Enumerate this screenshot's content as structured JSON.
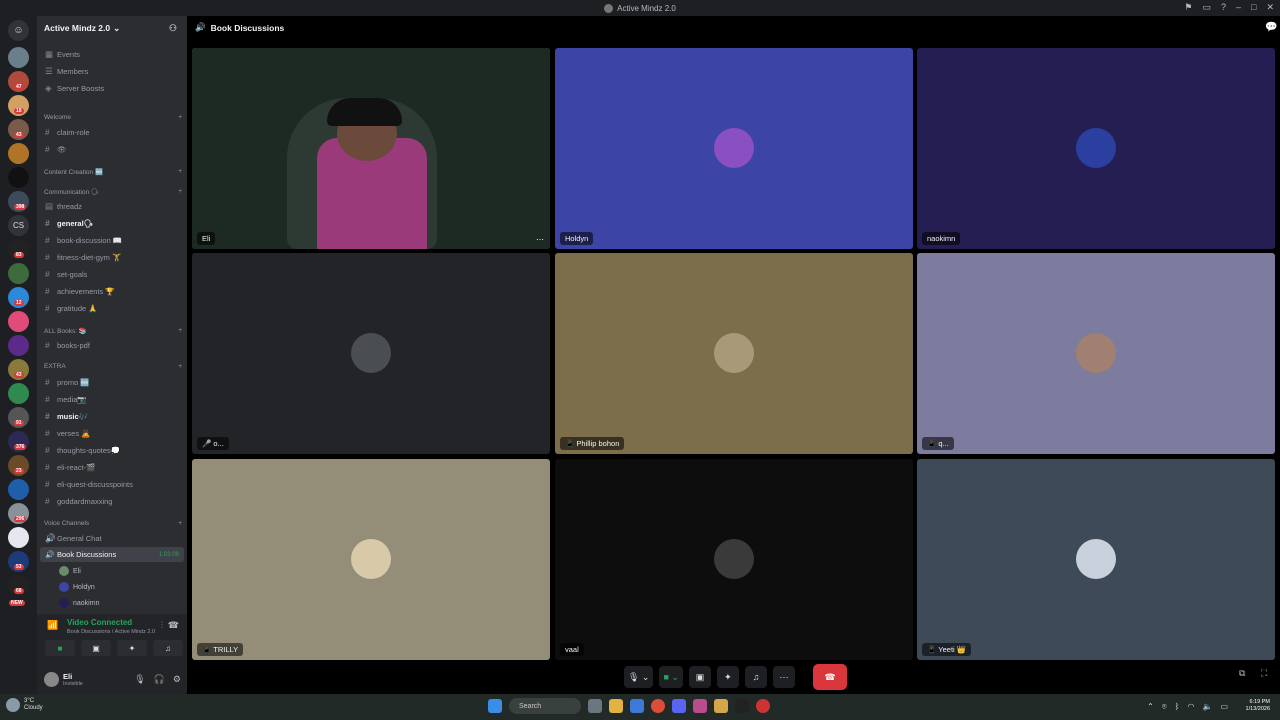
{
  "window": {
    "title": "Active Mindz 2.0"
  },
  "guild": {
    "name": "Active Mindz 2.0",
    "chevron": "⌄"
  },
  "nav_items": [
    {
      "label": "Events"
    },
    {
      "label": "Members"
    },
    {
      "label": "Server Boosts"
    }
  ],
  "categories": {
    "welcome": "Welcome",
    "content_creation": "Content Creation 🆕",
    "communication": "Communication 🗣",
    "all_books": "ALL Books: 📚",
    "extra": "EXTRA",
    "voice_channels": "Voice Channels"
  },
  "channels": {
    "claim_role": "claim-role",
    "emoji_ch": "👁",
    "threadz": "threadz",
    "general": "general🗣",
    "book_discussion": "book-discussion 📖",
    "fitness": "fitness-diet-gym 🏋",
    "set_goals": "set-goals",
    "achievements": "achievements 🏆",
    "gratitude": "gratitude 🙏",
    "books_pdf": "books-pdf",
    "promo": "promo 🆕",
    "media": "media📷",
    "music": "music🎶",
    "verses": "verses 🙇",
    "thoughts_quotes": "thoughts-quotes💭",
    "eli_react": "eli-react-🎬",
    "eli_quest": "eli-quest-discusspoints",
    "goddardmaxxing": "goddardmaxxing",
    "general_chat": "General Chat",
    "book_discussions_vc": "Book Discussions",
    "vc_time": "1:03:09"
  },
  "vc_users": [
    "Eli",
    "Holdyn",
    "naokimn"
  ],
  "rtc": {
    "status": "Video Connected",
    "subtitle": "Book Discussions / Active Mindz 2.0"
  },
  "user": {
    "name": "Eli",
    "status": "Invisible"
  },
  "server_badges": [
    "47",
    "18",
    "43",
    "398",
    "83",
    "1",
    "12",
    "40",
    "43",
    "276",
    "2",
    "91",
    "376",
    "23",
    "296",
    "53",
    "68"
  ],
  "server_new": "NEW",
  "server_cs": "CS",
  "stage": {
    "title": "Book Discussions"
  },
  "tiles": [
    {
      "label": "Eli",
      "bg": "#1a2a22"
    },
    {
      "label": "Holdyn",
      "bg": "#3c45a5"
    },
    {
      "label": "naokimn",
      "bg": "#251e52"
    },
    {
      "label": "🎤 o...",
      "bg": "#232428"
    },
    {
      "label": "📱 Phillip bohon",
      "bg": "#7c6e4a"
    },
    {
      "label": "📱 q...",
      "bg": "#7d7b9e"
    },
    {
      "label": "📱 TRILLY",
      "bg": "#948e78"
    },
    {
      "label": "vaal",
      "bg": "#0d0d0d"
    },
    {
      "label": "📱 Yeeti 👑",
      "bg": "#3e4a58"
    }
  ],
  "taskbar": {
    "temp": "3°C",
    "weather": "Cloudy",
    "search": "Search",
    "time": "6:19 PM",
    "date": "1/13/2026"
  },
  "colors": {
    "accent": "#5865f2",
    "green": "#23a55a",
    "red": "#da373c"
  }
}
